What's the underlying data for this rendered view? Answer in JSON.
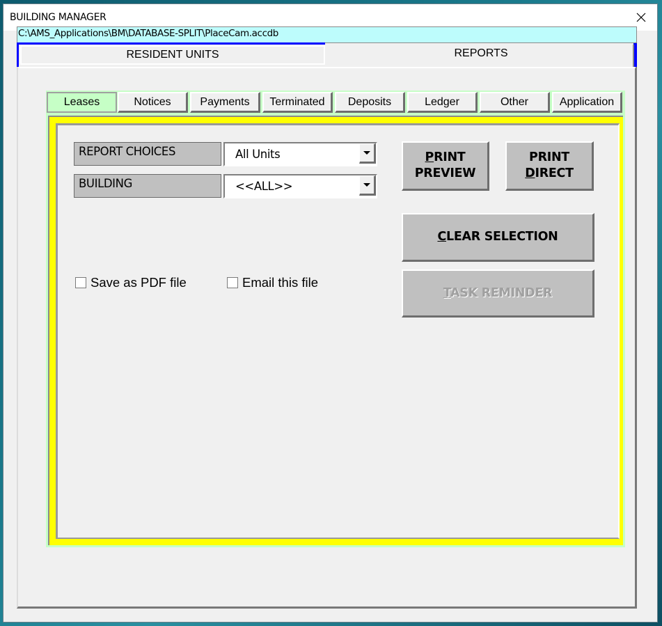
{
  "window": {
    "title": "BUILDING MANAGER",
    "close_icon": "close-x-icon"
  },
  "path_bar": {
    "text": "C:\\AMS_Applications\\BM\\DATABASE-SPLIT\\PlaceCam.accdb"
  },
  "top_tabs": [
    {
      "label": "RESIDENT UNITS",
      "active": false
    },
    {
      "label": "REPORTS",
      "active": true
    }
  ],
  "sub_tabs": [
    {
      "label": "Leases",
      "active": true
    },
    {
      "label": "Notices",
      "active": false
    },
    {
      "label": "Payments",
      "active": false
    },
    {
      "label": "Terminated",
      "active": false
    },
    {
      "label": "Deposits",
      "active": false
    },
    {
      "label": "Ledger",
      "active": false
    },
    {
      "label": "Other",
      "active": false
    },
    {
      "label": "Application",
      "active": false
    }
  ],
  "form": {
    "report_choices": {
      "label": "REPORT CHOICES",
      "value": "All Units"
    },
    "building": {
      "label": "BUILDING",
      "value": "<<ALL>>"
    },
    "save_pdf": {
      "label": "Save as PDF file",
      "checked": false
    },
    "email_file": {
      "label": "Email this file",
      "checked": false
    }
  },
  "buttons": {
    "print_preview": {
      "line1_accel": "P",
      "line1_rest": "RINT",
      "line2": "PREVIEW"
    },
    "print_direct": {
      "line1": "PRINT",
      "line2_accel": "D",
      "line2_rest": "IRECT"
    },
    "clear_selection": {
      "accel": "C",
      "rest": "LEAR SELECTION"
    },
    "task_reminder": {
      "accel": "T",
      "rest": "ASK REMINDER",
      "disabled": true
    }
  },
  "colors": {
    "path_bar_bg": "#bdfcfc",
    "active_tab_accent": "#0000ff",
    "subtab_active_bg": "#c6ffc6",
    "frame_yellow": "#ffff00",
    "button_face": "#c0c0c0"
  }
}
